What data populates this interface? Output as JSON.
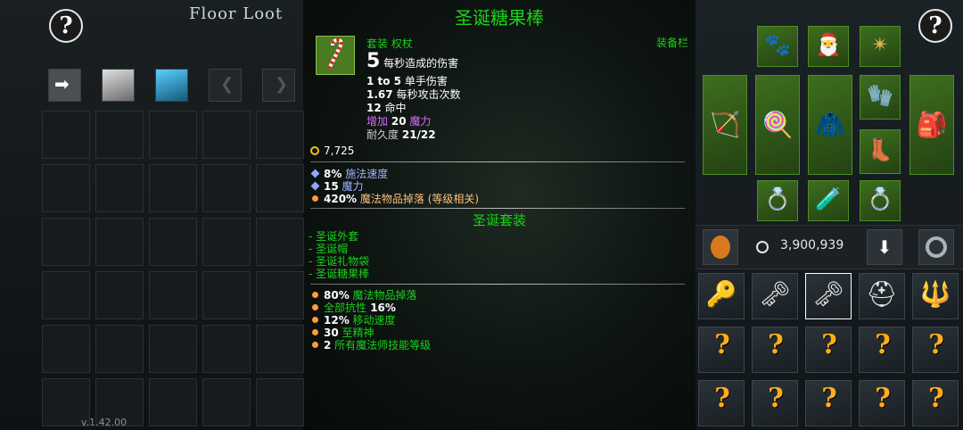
{
  "left_panel": {
    "title": "Floor Loot",
    "help_symbol": "?",
    "tool_buttons": [
      "arrow-right-icon",
      "white-square-icon",
      "blue-square-icon",
      "chevron-left-icon",
      "chevron-right-icon"
    ],
    "chevron_left": "❮",
    "chevron_right": "❯",
    "arrow": "➡",
    "version": "v.1.42.00"
  },
  "tooltip": {
    "title": "圣诞糖果棒",
    "type_line": "套装 权杖",
    "dps_value": "5",
    "dps_label": "每秒造成的伤害",
    "damage_range": "1 to 5",
    "damage_label": "单手伤害",
    "attack_speed": "1.67",
    "attack_speed_label": "每秒攻击次数",
    "accuracy": "12",
    "accuracy_label": "命中",
    "mana_prefix": "增加",
    "mana_value": "20",
    "mana_label": "魔力",
    "durability_label": "耐久度",
    "durability": "21/22",
    "price": "7,725",
    "bonus_stats": [
      {
        "value": "8%",
        "label": "施法速度",
        "bullet": "diamond"
      },
      {
        "value": "15",
        "label": "魔力",
        "bullet": "diamond"
      },
      {
        "value": "420%",
        "label": "魔法物品掉落 (等级相关)",
        "bullet": "dot"
      }
    ],
    "set_title": "圣诞套装",
    "set_items": [
      "- 圣诞外套",
      "- 圣诞帽",
      "- 圣诞礼物袋",
      "- 圣诞糖果棒"
    ],
    "set_bonuses": [
      {
        "value": "80%",
        "label": " 魔法物品掉落"
      },
      {
        "value": "全部抗性",
        "label": " 16%"
      },
      {
        "value": "12%",
        "label": " 移动速度"
      },
      {
        "value": "30",
        "label": " 至精神"
      },
      {
        "value": "2",
        "label": " 所有魔法师技能等级"
      }
    ]
  },
  "equipment": {
    "label": "装备栏",
    "slots": [
      {
        "name": "pet-slot",
        "glyph": "🐾"
      },
      {
        "name": "helmet-slot",
        "glyph": "🎅"
      },
      {
        "name": "amulet-slot",
        "glyph": "✴"
      },
      {
        "name": "offhand-slot",
        "glyph": "🏹"
      },
      {
        "name": "weapon-slot",
        "glyph": "🍭"
      },
      {
        "name": "armor-slot",
        "glyph": "🧥"
      },
      {
        "name": "gloves-slot",
        "glyph": "🧤"
      },
      {
        "name": "bag-slot",
        "glyph": "🎒"
      },
      {
        "name": "boots-slot",
        "glyph": "👢"
      },
      {
        "name": "ring-left-slot",
        "glyph": "💍"
      },
      {
        "name": "potion-slot",
        "glyph": "🧪"
      },
      {
        "name": "ring-right-slot",
        "glyph": "💍"
      }
    ]
  },
  "gold": {
    "amount": "3,900,939",
    "down_arrow": "⬇"
  },
  "inventory": {
    "question_mark": "?",
    "row1": [
      {
        "name": "keyring-item",
        "glyph": "🔑"
      },
      {
        "name": "bronze-key-item",
        "glyph": "🗝"
      },
      {
        "name": "silver-key-item",
        "glyph": "🗝"
      },
      {
        "name": "helmet-item",
        "glyph": "⛑"
      },
      {
        "name": "staff-item",
        "glyph": "🔱"
      }
    ],
    "unidentified_count_visible": 10
  },
  "colors": {
    "set_green": "#19d219",
    "gold": "#f2c21a",
    "mana_purple": "#d96bff",
    "unknown_orange": "#ffae1a"
  }
}
